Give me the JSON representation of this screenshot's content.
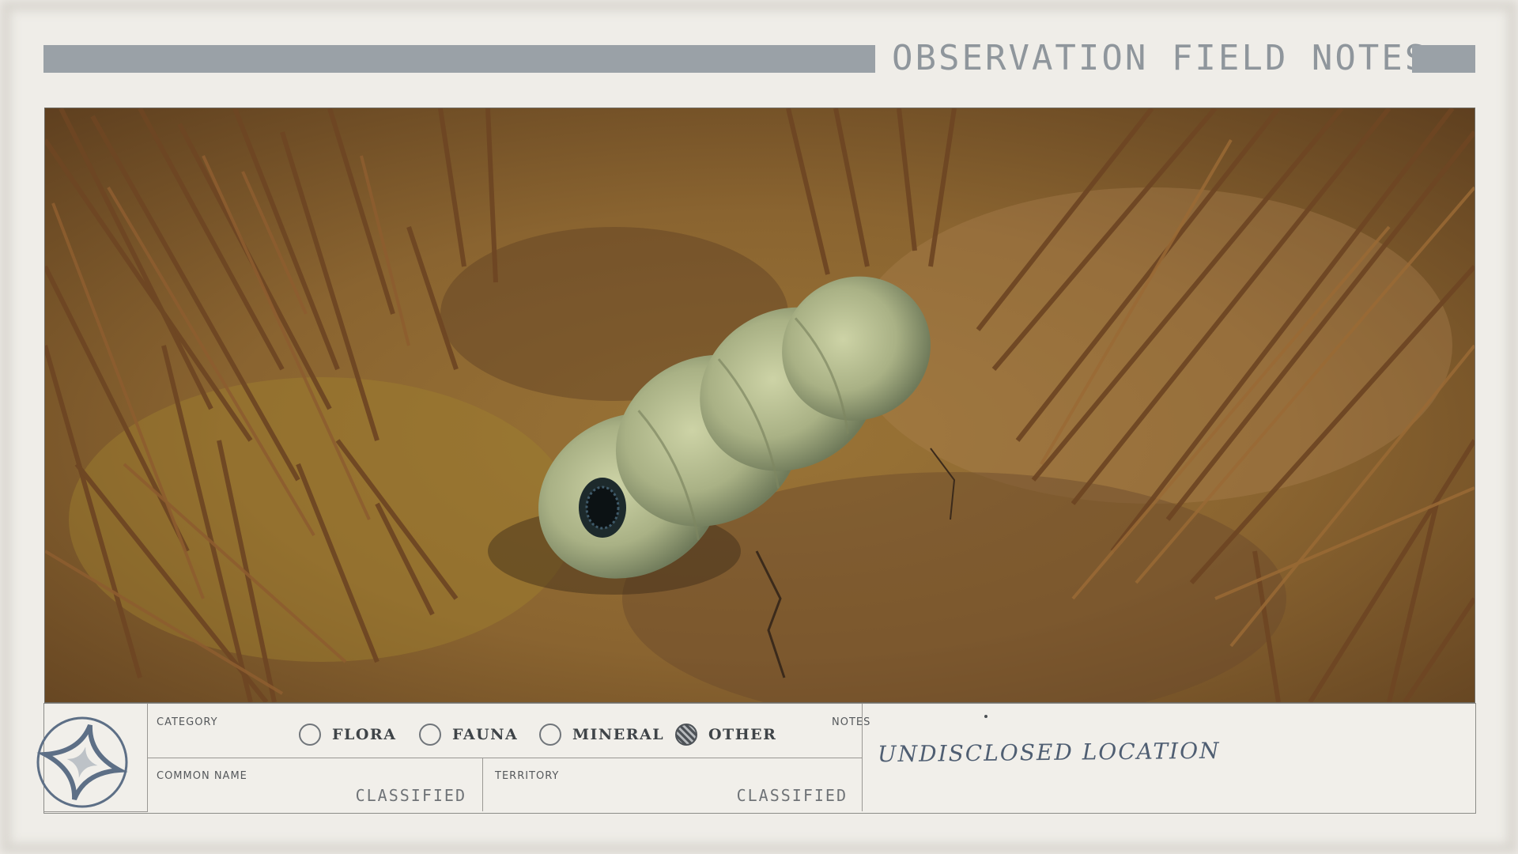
{
  "header": {
    "title": "OBSERVATION FIELD NOTES"
  },
  "category": {
    "label": "CATEGORY",
    "options": [
      {
        "label": "FLORA",
        "selected": false
      },
      {
        "label": "FAUNA",
        "selected": false
      },
      {
        "label": "MINERAL",
        "selected": false
      },
      {
        "label": "OTHER",
        "selected": true
      }
    ]
  },
  "common_name": {
    "label": "COMMON NAME",
    "value": "CLASSIFIED"
  },
  "territory": {
    "label": "TERRITORY",
    "value": "CLASSIFIED"
  },
  "notes": {
    "label": "NOTES",
    "text": "UNDISCLOSED LOCATION"
  },
  "icons": {
    "emblem": "compass-star-emblem",
    "selected_radio": "hatched-radio"
  },
  "colors": {
    "header_bar": "#9aa1a7",
    "ink": "#4f5e72",
    "paper": "#efede8"
  }
}
